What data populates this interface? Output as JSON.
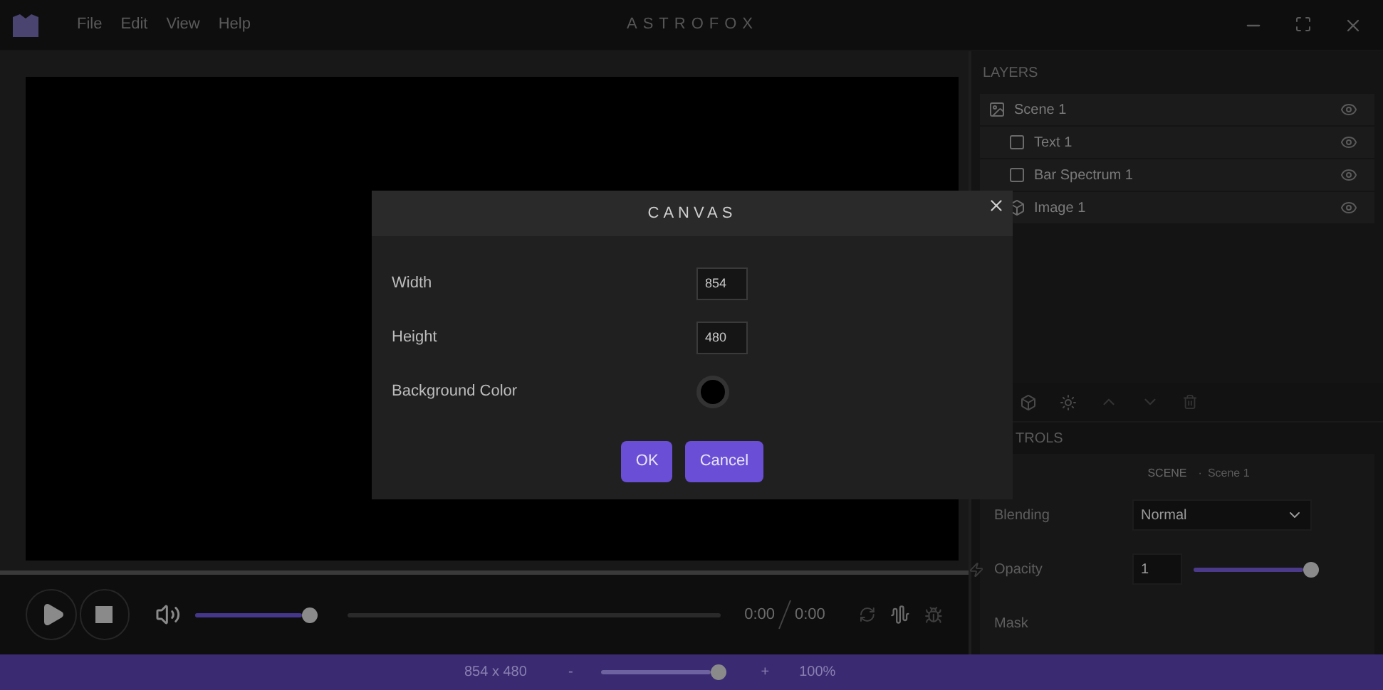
{
  "app": {
    "title": "ASTROFOX",
    "menu": [
      "File",
      "Edit",
      "View",
      "Help"
    ]
  },
  "layers": {
    "title": "LAYERS",
    "items": [
      {
        "name": "Scene 1",
        "kind": "scene",
        "children": [
          {
            "name": "Text 1",
            "kind": "display"
          },
          {
            "name": "Bar Spectrum 1",
            "kind": "display"
          },
          {
            "name": "Image 1",
            "kind": "image"
          }
        ]
      }
    ]
  },
  "controls": {
    "title": "TROLS",
    "section": "SCENE",
    "separator": "·",
    "section_name": "Scene 1",
    "fields": [
      {
        "label": "Blending",
        "kind": "select",
        "value": "Normal"
      },
      {
        "label": "Opacity",
        "kind": "slider",
        "value": "1",
        "level": 1
      },
      {
        "label": "Mask",
        "kind": "label"
      }
    ]
  },
  "player": {
    "volume": {
      "level": 1
    },
    "time": "0:00",
    "duration": "0:00"
  },
  "status": {
    "resolution": "854 x 480",
    "zoom_out": "-",
    "zoom": {
      "level": 1
    },
    "zoom_in": "+",
    "zoom_reading": "100%"
  },
  "dialog": {
    "title": "CANVAS",
    "fields": [
      {
        "label": "Width",
        "kind": "number",
        "value": "854"
      },
      {
        "label": "Height",
        "kind": "number",
        "value": "480"
      },
      {
        "label": "Background Color",
        "kind": "color",
        "color": "#000000"
      }
    ],
    "buttons": [
      "OK",
      "Cancel"
    ]
  }
}
